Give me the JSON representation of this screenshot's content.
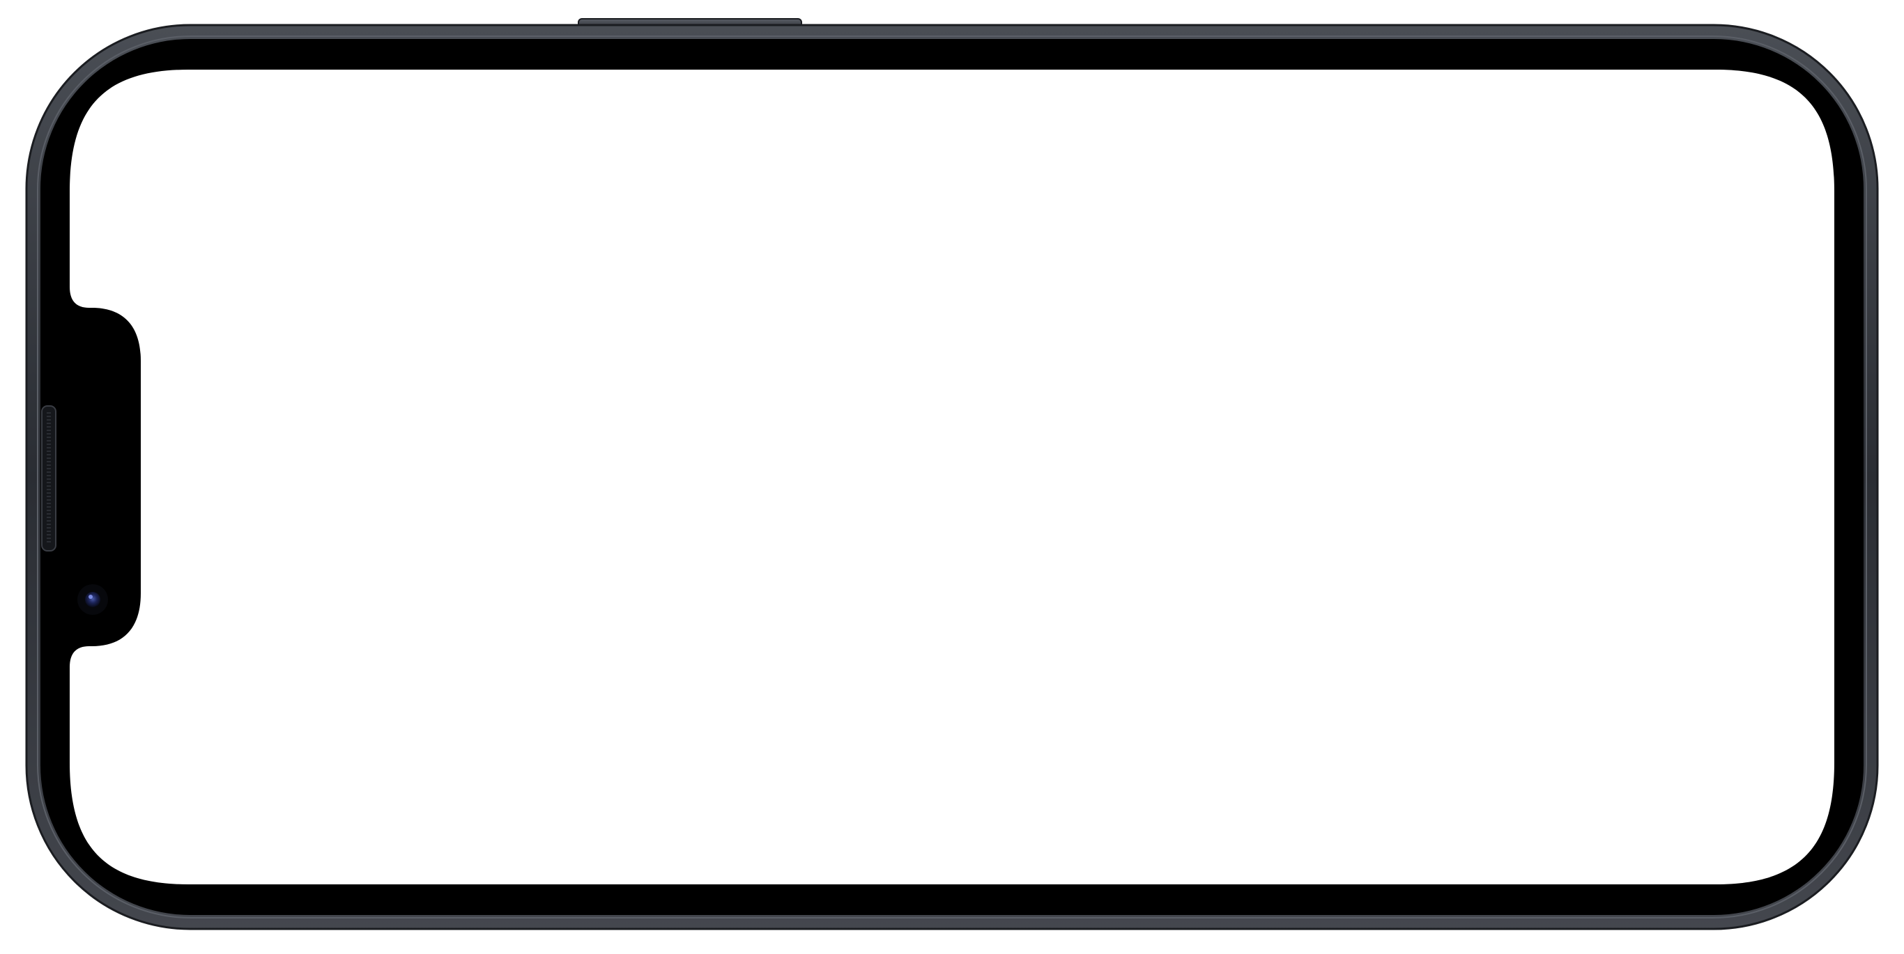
{
  "device": {
    "model": "iPhone",
    "orientation": "landscape",
    "frame_color": "#2c2f35",
    "bezel_color": "#000000",
    "screen_color": "#ffffff",
    "camera_lens_color": "#1c2458"
  }
}
